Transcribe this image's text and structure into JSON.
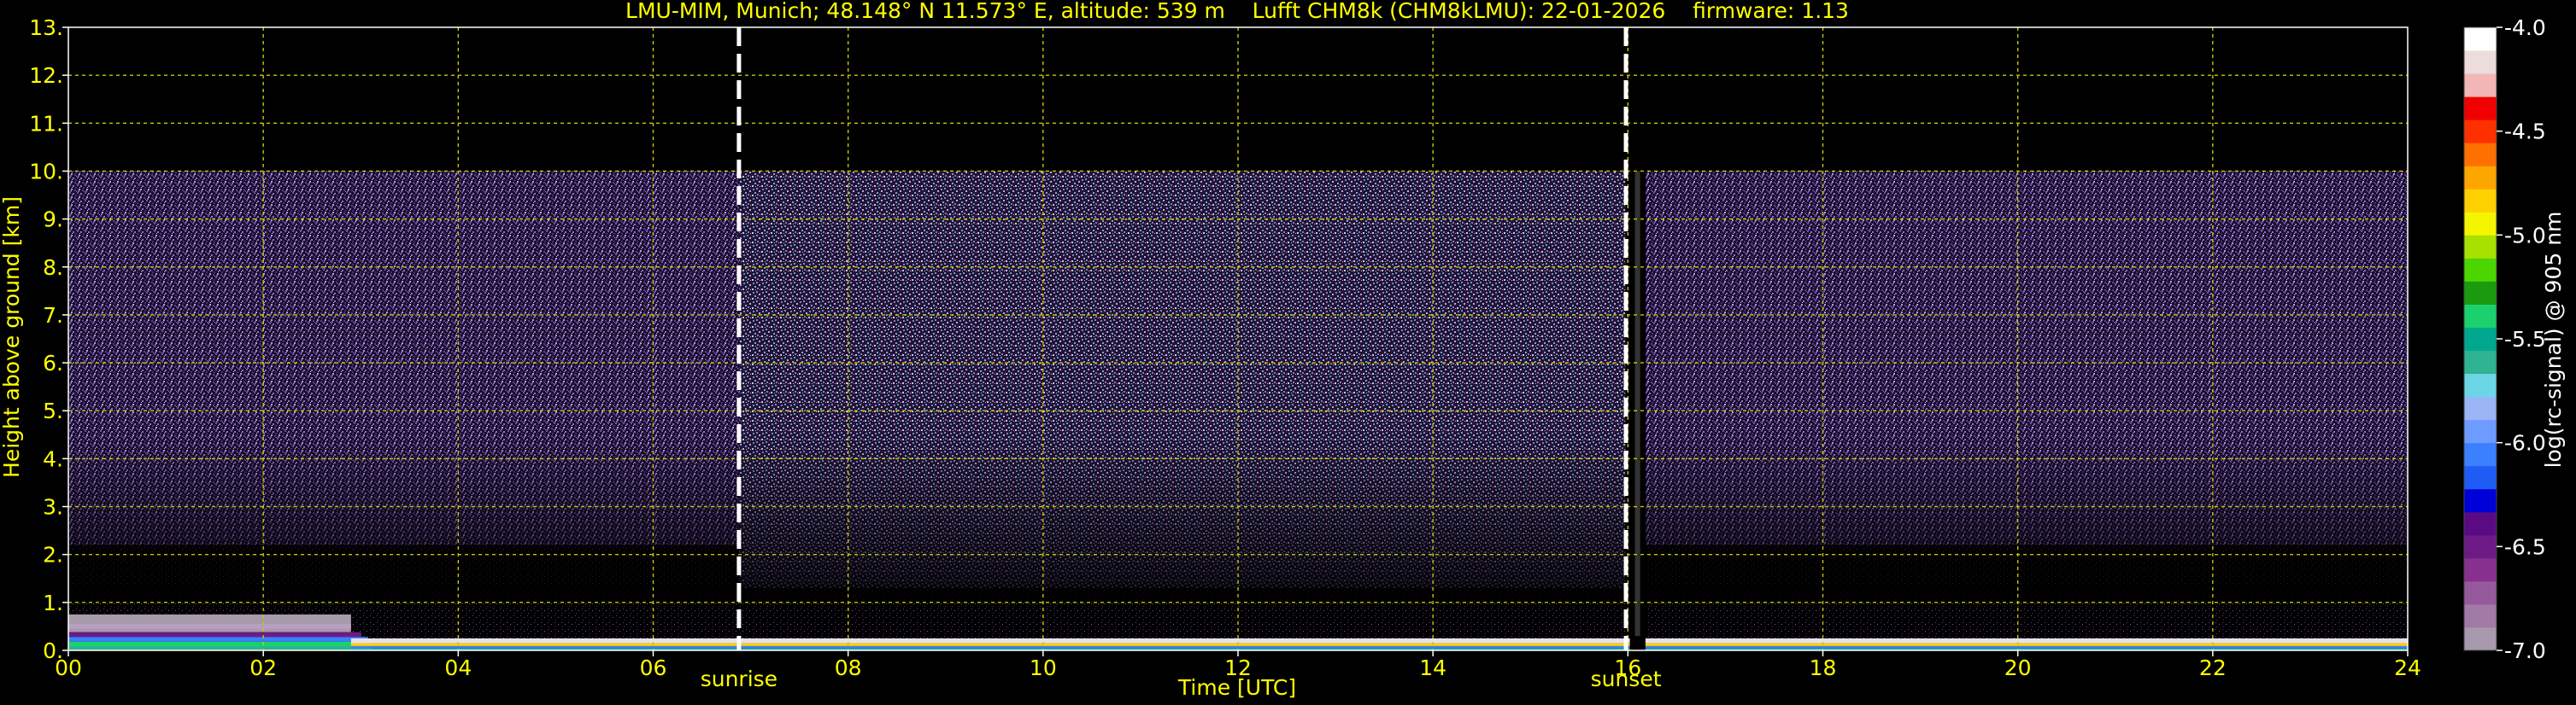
{
  "header": {
    "title": "LMU-MIM, Munich; 48.148° N 11.573° E, altitude: 539 m    Lufft CHM8k (CHM8kLMU): 22-01-2026    firmware: 1.13"
  },
  "chart_data": {
    "type": "heatmap",
    "title": "LMU-MIM, Munich; 48.148° N 11.573° E, altitude: 539 m    Lufft CHM8k (CHM8kLMU): 22-01-2026    firmware: 1.13",
    "xlabel": "Time [UTC]",
    "ylabel": "Height above ground [km]",
    "xlim": [
      0,
      24
    ],
    "ylim": [
      0,
      13
    ],
    "x_ticks": [
      "00",
      "02",
      "04",
      "06",
      "08",
      "10",
      "12",
      "14",
      "16",
      "18",
      "20",
      "22",
      "24"
    ],
    "y_ticks": [
      "0.",
      "1.",
      "2.",
      "3.",
      "4.",
      "5.",
      "6.",
      "7.",
      "8.",
      "9.",
      "10.",
      "11.",
      "12.",
      "13."
    ],
    "grid": true,
    "markers": [
      {
        "label": "sunrise",
        "x": 6.88
      },
      {
        "label": "sunset",
        "x": 15.98
      }
    ],
    "data_gap": {
      "x_start": 16.02,
      "x_end": 16.18
    },
    "signal_top_km": 10.0,
    "colorbar": {
      "label": "log(rc-signal) @ 905 nm",
      "range": [
        -7.0,
        -4.0
      ],
      "ticks": [
        "-4.0",
        "-4.5",
        "-5.0",
        "-5.5",
        "-6.0",
        "-6.5",
        "-7.0"
      ],
      "colors": [
        "#a89aac",
        "#a27aa6",
        "#965a9c",
        "#883090",
        "#6e1a86",
        "#5a0a82",
        "#0000d8",
        "#1e5cf5",
        "#3a80ff",
        "#6e9bff",
        "#9ab4f5",
        "#6bd7e6",
        "#2fb392",
        "#00a890",
        "#1bd16e",
        "#1a9a0e",
        "#4cd600",
        "#a8e000",
        "#f5f500",
        "#ffd000",
        "#ffa500",
        "#ff7000",
        "#ff3000",
        "#f00000",
        "#f2b6b6",
        "#ecdcdc",
        "#ffffff"
      ]
    },
    "series": [
      {
        "time_range": [
          0,
          2.9
        ],
        "low_layer_top_km": 0.75,
        "note_colors": [
          "#ffffff",
          "#9ab4f5",
          "#2fb392",
          "#6e1a86",
          "#a89aac"
        ]
      },
      {
        "time_range": [
          2.9,
          24
        ],
        "surface_layer_top_km": 0.25
      }
    ]
  }
}
